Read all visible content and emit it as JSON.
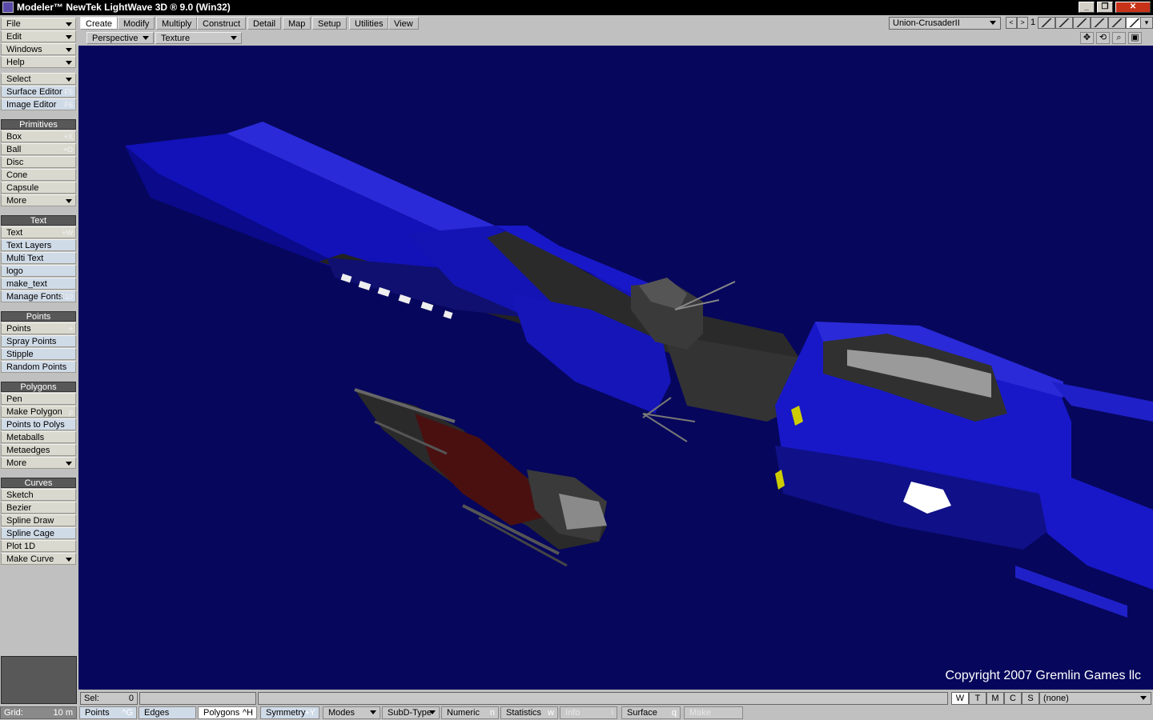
{
  "window": {
    "title": "Modeler™ NewTek LightWave 3D ® 9.0 (Win32)"
  },
  "tabs": [
    "Create",
    "Modify",
    "Multiply",
    "Construct",
    "Detail",
    "Map",
    "Setup",
    "Utilities",
    "View"
  ],
  "active_tab": "Create",
  "menus": {
    "file": "File",
    "edit": "Edit",
    "windows": "Windows",
    "help": "Help",
    "select": "Select",
    "surface_editor": "Surface Editor",
    "surface_editor_sc": "F5",
    "image_editor": "Image Editor",
    "image_editor_sc": "F6"
  },
  "primitives": {
    "header": "Primitives",
    "box": "Box",
    "box_sc": "+X",
    "ball": "Ball",
    "ball_sc": "+O",
    "disc": "Disc",
    "cone": "Cone",
    "capsule": "Capsule",
    "more": "More"
  },
  "text": {
    "header": "Text",
    "text": "Text",
    "text_sc": "+W",
    "text_layers": "Text Layers",
    "multi_text": "Multi Text",
    "logo": "logo",
    "make_text": "make_text",
    "manage_fonts": "Manage Fonts",
    "manage_fonts_sc": "F10"
  },
  "points": {
    "header": "Points",
    "points": "Points",
    "points_sc": "+",
    "spray_points": "Spray Points",
    "stipple": "Stipple",
    "random_points": "Random Points"
  },
  "polygons": {
    "header": "Polygons",
    "pen": "Pen",
    "make_polygon": "Make Polygon",
    "make_polygon_sc": "p",
    "points_to_polys": "Points to Polys",
    "metaballs": "Metaballs",
    "metaedges": "Metaedges",
    "more": "More"
  },
  "curves": {
    "header": "Curves",
    "sketch": "Sketch",
    "bezier": "Bezier",
    "spline_draw": "Spline Draw",
    "spline_cage": "Spline Cage",
    "plot_1d": "Plot 1D",
    "make_curve": "Make Curve"
  },
  "viewport": {
    "view_type": "Perspective",
    "render_mode": "Texture",
    "copyright": "Copyright 2007 Gremlin Games llc",
    "bg_color": "#06065c"
  },
  "object_selector": {
    "value": "Union-CrusaderII",
    "layer_page": "1"
  },
  "status": {
    "sel_label": "Sel:",
    "sel_value": "0",
    "grid_label": "Grid:",
    "grid_value": "10 m"
  },
  "wtmcs": [
    "W",
    "T",
    "M",
    "C",
    "S"
  ],
  "surface_select": "(none)",
  "bottom": {
    "points": "Points",
    "points_sc": "^G",
    "edges": "Edges",
    "polygons": "Polygons",
    "polygons_sc": "^H",
    "symmetry": "Symmetry",
    "symmetry_sc": "+Y",
    "modes": "Modes",
    "subd_type": "SubD-Type",
    "numeric": "Numeric",
    "numeric_sc": "n",
    "statistics": "Statistics",
    "statistics_sc": "w",
    "info": "Info",
    "info_sc": "i",
    "surface": "Surface",
    "surface_sc": "q",
    "make": "Make"
  }
}
